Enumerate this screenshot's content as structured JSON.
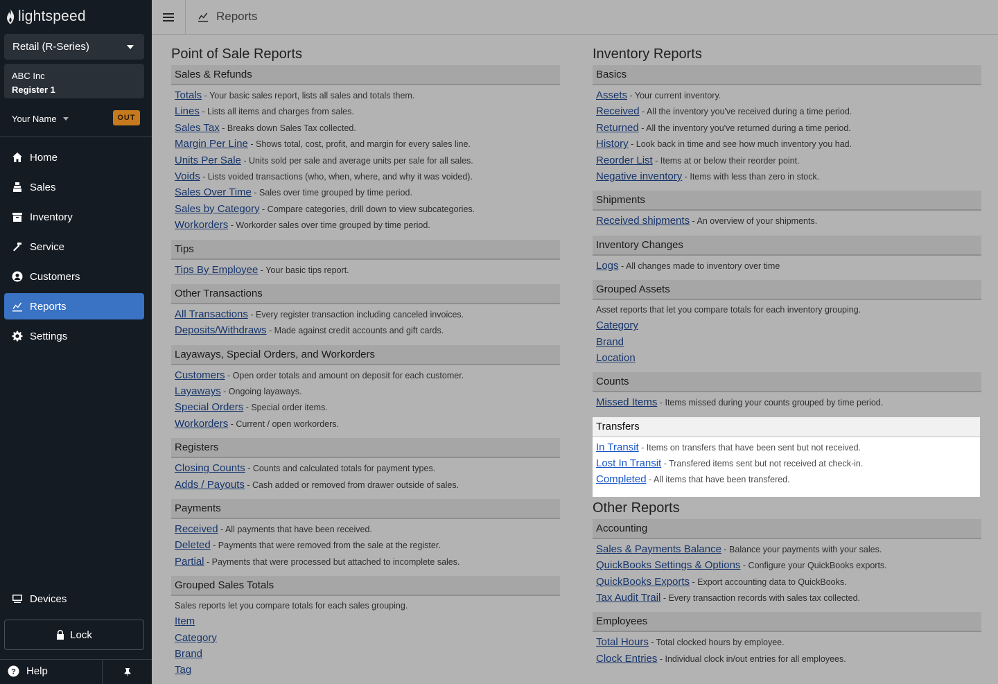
{
  "app": {
    "logo_text": "lightspeed",
    "product": "Retail (R-Series)",
    "company": "ABC Inc",
    "register": "Register 1",
    "user_name": "Your Name",
    "status_badge": "OUT"
  },
  "nav": {
    "items": [
      {
        "label": "Home",
        "icon": "home-icon"
      },
      {
        "label": "Sales",
        "icon": "sales-icon"
      },
      {
        "label": "Inventory",
        "icon": "inventory-icon"
      },
      {
        "label": "Service",
        "icon": "service-icon"
      },
      {
        "label": "Customers",
        "icon": "customers-icon"
      },
      {
        "label": "Reports",
        "icon": "reports-icon",
        "active": true
      },
      {
        "label": "Settings",
        "icon": "settings-icon"
      }
    ],
    "devices": "Devices",
    "lock": "Lock",
    "help": "Help"
  },
  "header": {
    "title": "Reports"
  },
  "colors": {
    "sidebar_bg": "#151b22",
    "active_nav": "#3a72c4",
    "out_badge": "#c67a1d",
    "link": "#17356b",
    "highlight_link": "#1a56c7"
  },
  "sections": {
    "pos": {
      "title": "Point of Sale Reports",
      "groups": [
        {
          "title": "Sales & Refunds",
          "items": [
            {
              "link": "Totals",
              "desc": " - Your basic sales report, lists all sales and totals them."
            },
            {
              "link": "Lines",
              "desc": " - Lists all items and charges from sales."
            },
            {
              "link": "Sales Tax",
              "desc": " - Breaks down Sales Tax collected."
            },
            {
              "link": "Margin Per Line",
              "desc": " - Shows total, cost, profit, and margin for every sales line."
            },
            {
              "link": "Units Per Sale",
              "desc": " - Units sold per sale and average units per sale for all sales."
            },
            {
              "link": "Voids",
              "desc": " - Lists voided transactions (who, when, where, and why it was voided)."
            },
            {
              "link": "Sales Over Time",
              "desc": " - Sales over time grouped by time period."
            },
            {
              "link": "Sales by Category",
              "desc": " - Compare categories, drill down to view subcategories."
            },
            {
              "link": "Workorders",
              "desc": " - Workorder sales over time grouped by time period."
            }
          ]
        },
        {
          "title": "Tips",
          "items": [
            {
              "link": "Tips By Employee",
              "desc": " - Your basic tips report."
            }
          ]
        },
        {
          "title": "Other Transactions",
          "items": [
            {
              "link": "All Transactions",
              "desc": " - Every register transaction including canceled invoices."
            },
            {
              "link": "Deposits/Withdraws",
              "desc": " - Made against credit accounts and gift cards."
            }
          ]
        },
        {
          "title": "Layaways, Special Orders, and Workorders",
          "items": [
            {
              "link": "Customers",
              "desc": " - Open order totals and amount on deposit for each customer."
            },
            {
              "link": "Layaways",
              "desc": " - Ongoing layaways."
            },
            {
              "link": "Special Orders",
              "desc": " - Special order items."
            },
            {
              "link": "Workorders",
              "desc": " - Current / open workorders."
            }
          ]
        },
        {
          "title": "Registers",
          "items": [
            {
              "link": "Closing Counts",
              "desc": " - Counts and calculated totals for payment types."
            },
            {
              "link": "Adds / Payouts",
              "desc": " - Cash added or removed from drawer outside of sales."
            }
          ]
        },
        {
          "title": "Payments",
          "items": [
            {
              "link": "Received",
              "desc": " - All payments that have been received."
            },
            {
              "link": "Deleted",
              "desc": " - Payments that were removed from the sale at the register."
            },
            {
              "link": "Partial",
              "desc": " - Payments that were processed but attached to incomplete sales."
            }
          ]
        },
        {
          "title": "Grouped Sales Totals",
          "description": "Sales reports let you compare totals for each sales grouping.",
          "items": [
            {
              "link": "Item",
              "desc": ""
            },
            {
              "link": "Category",
              "desc": ""
            },
            {
              "link": "Brand",
              "desc": ""
            },
            {
              "link": "Tag",
              "desc": ""
            }
          ]
        }
      ]
    },
    "inventory": {
      "title": "Inventory Reports",
      "groups": [
        {
          "title": "Basics",
          "items": [
            {
              "link": "Assets",
              "desc": " - Your current inventory."
            },
            {
              "link": "Received",
              "desc": " - All the inventory you've received during a time period."
            },
            {
              "link": "Returned",
              "desc": " - All the inventory you've returned during a time period."
            },
            {
              "link": "History",
              "desc": " - Look back in time and see how much inventory you had."
            },
            {
              "link": "Reorder List",
              "desc": " - Items at or below their reorder point."
            },
            {
              "link": "Negative inventory",
              "desc": " - Items with less than zero in stock."
            }
          ]
        },
        {
          "title": "Shipments",
          "items": [
            {
              "link": "Received shipments",
              "desc": " - An overview of your shipments."
            }
          ]
        },
        {
          "title": "Inventory Changes",
          "items": [
            {
              "link": "Logs",
              "desc": " - All changes made to inventory over time"
            }
          ]
        },
        {
          "title": "Grouped Assets",
          "description": "Asset reports that let you compare totals for each inventory grouping.",
          "items": [
            {
              "link": "Category",
              "desc": ""
            },
            {
              "link": "Brand",
              "desc": ""
            },
            {
              "link": "Location",
              "desc": ""
            }
          ]
        },
        {
          "title": "Counts",
          "items": [
            {
              "link": "Missed Items",
              "desc": " - Items missed during your counts grouped by time period."
            }
          ]
        },
        {
          "title": "Transfers",
          "highlighted": true,
          "items": [
            {
              "link": "In Transit",
              "desc": " - Items on transfers that have been sent but not received."
            },
            {
              "link": "Lost In Transit",
              "desc": " - Transfered items sent but not received at check-in."
            },
            {
              "link": "Completed",
              "desc": " - All items that have been transfered."
            }
          ]
        }
      ]
    },
    "other": {
      "title": "Other Reports",
      "groups": [
        {
          "title": "Accounting",
          "items": [
            {
              "link": "Sales & Payments Balance",
              "desc": " - Balance your payments with your sales."
            },
            {
              "link": "QuickBooks Settings & Options",
              "desc": " - Configure your QuickBooks exports."
            },
            {
              "link": "QuickBooks Exports",
              "desc": " - Export accounting data to QuickBooks."
            },
            {
              "link": "Tax Audit Trail",
              "desc": " - Every transaction records with sales tax collected."
            }
          ]
        },
        {
          "title": "Employees",
          "items": [
            {
              "link": "Total Hours",
              "desc": " - Total clocked hours by employee."
            },
            {
              "link": "Clock Entries",
              "desc": " - Individual clock in/out entries for all employees."
            }
          ]
        }
      ]
    }
  }
}
